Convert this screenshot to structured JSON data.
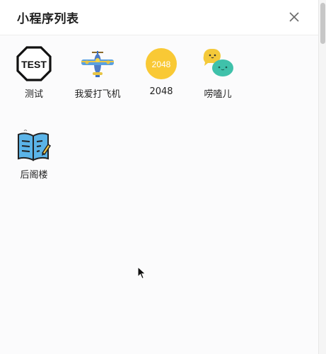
{
  "header": {
    "title": "小程序列表"
  },
  "apps": [
    {
      "label": "测试",
      "icon_text": "TEST"
    },
    {
      "label": "我爱打飞机"
    },
    {
      "label": "2048",
      "icon_text": "2048"
    },
    {
      "label": "唠嗑儿"
    },
    {
      "label": "后阁楼"
    }
  ]
}
